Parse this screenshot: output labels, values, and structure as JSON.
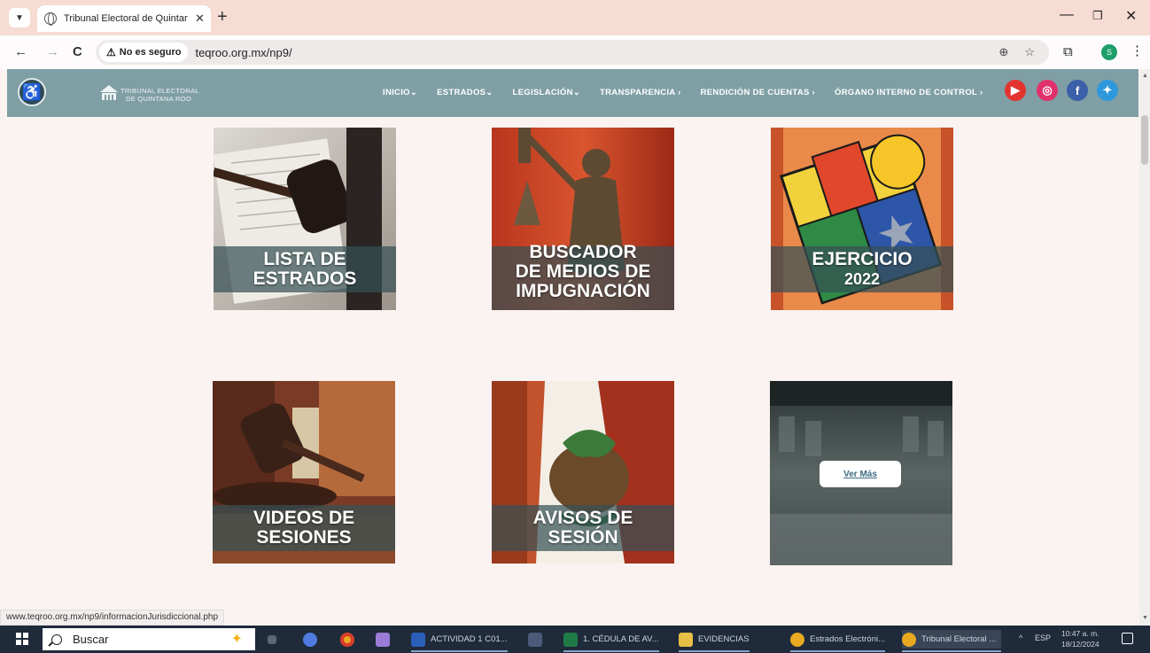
{
  "browser": {
    "tab_title": "Tribunal Electoral de Quintana",
    "tab_close": "✕",
    "new_tab": "+",
    "security_label": "No es seguro",
    "url": "teqroo.org.mx/np9/",
    "status_url": "www.teqroo.org.mx/np9/informacionJurisdiccional.php",
    "profile_initial": "S"
  },
  "site": {
    "logo_line1": "TRIBUNAL ELECTORAL",
    "logo_line2": "DE QUINTANA ROO",
    "menu": [
      "INICIO⌄",
      "ESTRADOS⌄",
      "LEGISLACIÓN⌄",
      "TRANSPARENCIA ›",
      "RENDICIÓN DE CUENTAS ›",
      "ÓRGANO INTERNO DE CONTROL ›"
    ],
    "social": [
      "youtube",
      "instagram",
      "facebook",
      "twitter"
    ]
  },
  "tiles": [
    {
      "line1": "LISTA DE",
      "line2": "ESTRADOS"
    },
    {
      "line1": "BUSCADOR",
      "line2": "DE MEDIOS DE",
      "line3": "IMPUGNACIÓN"
    },
    {
      "line1": "EJERCICIO",
      "line2": "2022"
    },
    {
      "line1": "VIDEOS DE",
      "line2": "SESIONES"
    },
    {
      "line1": "AVISOS DE",
      "line2": "SESIÓN"
    },
    {
      "button": "Ver Más"
    }
  ],
  "taskbar": {
    "search_label": "Buscar",
    "items": [
      "ACTIVIDAD 1 C01...",
      "1. CÉDULA DE AV...",
      "EVIDENCIAS",
      "Estrados Electróni...",
      "Tribunal Electoral ..."
    ],
    "language": "ESP",
    "time": "10:47 a. m.",
    "date": "18/12/2024"
  },
  "colors": {
    "header": "#7f9fa4",
    "tabstrip": "#f6dcd3",
    "page_bg": "#fbf3f1",
    "taskbar": "#1f2a3a"
  }
}
